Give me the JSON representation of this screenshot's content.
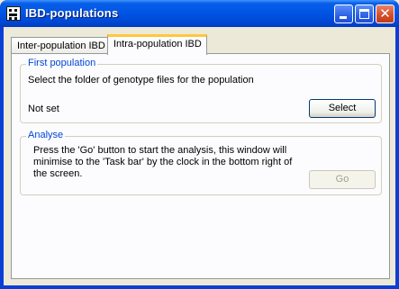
{
  "window": {
    "title": "IBD-populations"
  },
  "tabs": [
    {
      "label": "Inter-population IBD",
      "active": false
    },
    {
      "label": "Intra-population IBD",
      "active": true
    }
  ],
  "first_population": {
    "legend": "First population",
    "instruction": "Select the folder of genotype files for the population",
    "status": "Not set",
    "select_button": "Select"
  },
  "analyse": {
    "legend": "Analyse",
    "description": "Press the 'Go' button to start the analysis, this window will minimise to the 'Task bar' by the clock in the bottom right of the screen.",
    "go_button": "Go",
    "go_enabled": false
  },
  "colors": {
    "titlebar": "#0055e5",
    "group_legend": "#0046d5",
    "active_tab_accent": "#ffc83c"
  }
}
